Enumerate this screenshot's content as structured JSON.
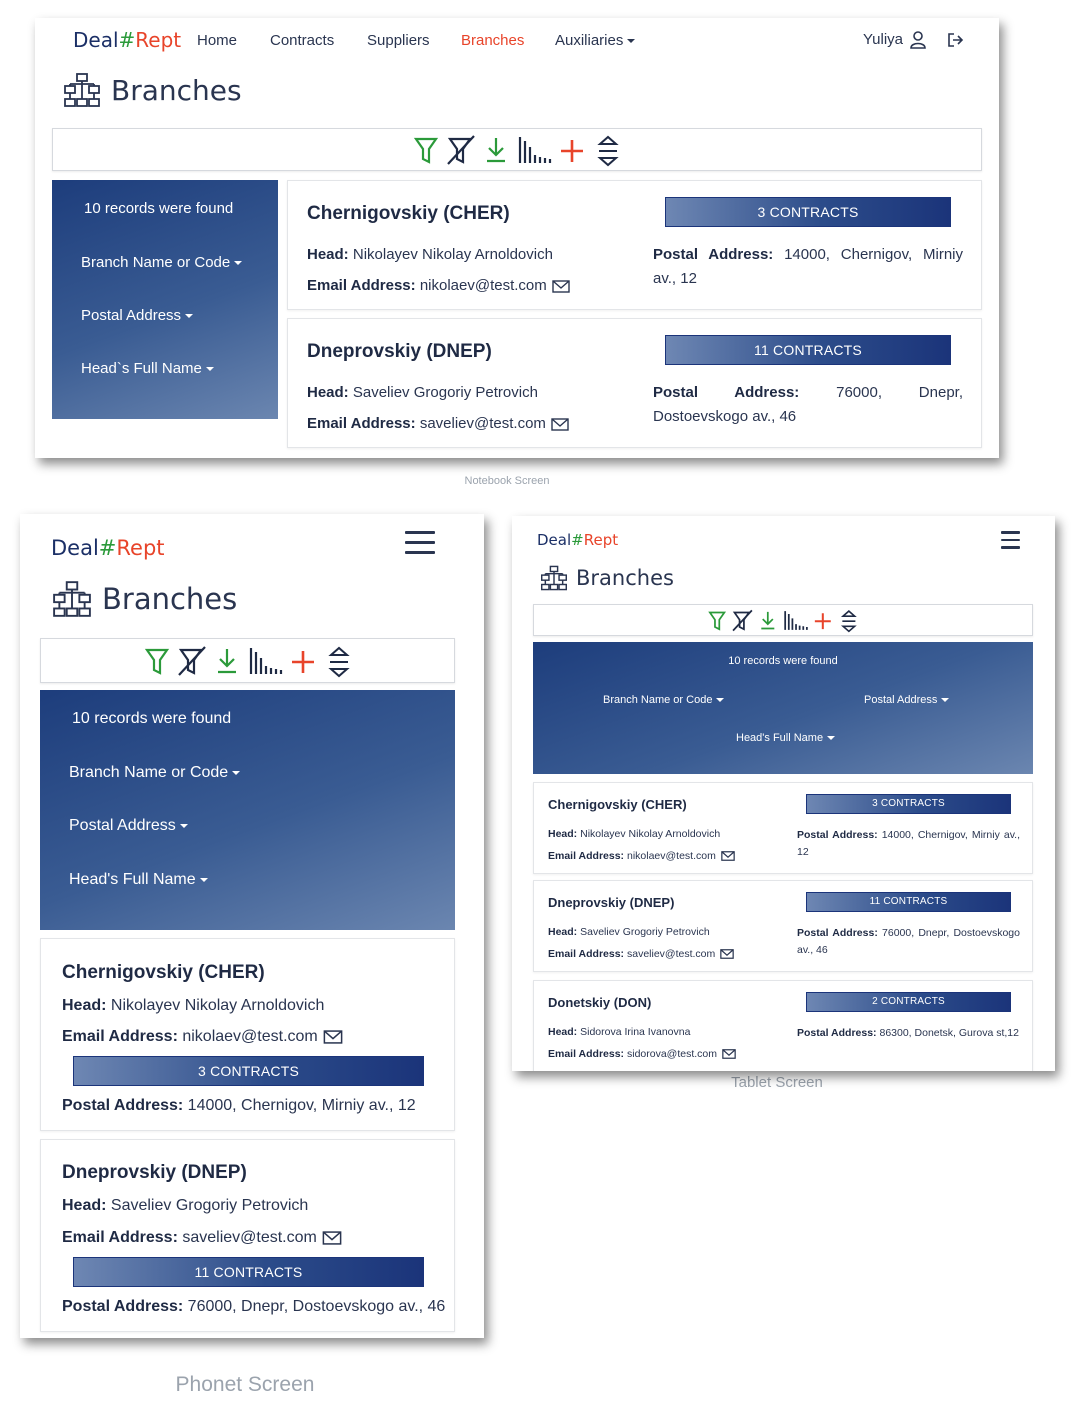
{
  "brand": {
    "deal": "Deal",
    "hash": "#",
    "rept": "Rept"
  },
  "nav": {
    "home": "Home",
    "contracts": "Contracts",
    "suppliers": "Suppliers",
    "branches": "Branches",
    "auxiliaries": "Auxiliaries",
    "user": "Yuliya"
  },
  "page": {
    "title": "Branches"
  },
  "filters": {
    "records_found": "10 records were found",
    "branch_name": "Branch Name or Code",
    "postal_address": "Postal Address",
    "head_full_name": "Head`s Full Name",
    "head_full_name_alt": "Head's Full Name"
  },
  "labels": {
    "head": "Head:",
    "email": "Email Address:",
    "postal": "Postal Address:",
    "postal_word": "Postal",
    "address_word": "Address:"
  },
  "branches": [
    {
      "title": "Chernigovskiy (CHER)",
      "head": "Nikolayev Nikolay Arnoldovich",
      "email": "nikolaev@test.com",
      "contracts": "3 CONTRACTS",
      "postal": "14000, Chernigov, Mirniy av., 12"
    },
    {
      "title": "Dneprovskiy (DNEP)",
      "head": "Saveliev Grogoriy Petrovich",
      "email": "saveliev@test.com",
      "contracts": "11 CONTRACTS",
      "postal": "76000, Dnepr, Dostoevskogo av., 46"
    },
    {
      "title": "Donetskiy (DON)",
      "head": "Sidorova Irina Ivanovna",
      "email": "sidorova@test.com",
      "contracts": "2 CONTRACTS",
      "postal": "86300, Donetsk, Gurova st,12"
    }
  ],
  "captions": {
    "notebook": "Notebook Screen",
    "tablet": "Tablet Screen",
    "phone": "Phonet Screen"
  },
  "colors": {
    "brand_dark": "#1b2f66",
    "brand_green": "#2b9a3a",
    "brand_red": "#e8442a",
    "panel_blue": "#1d3d7c"
  }
}
